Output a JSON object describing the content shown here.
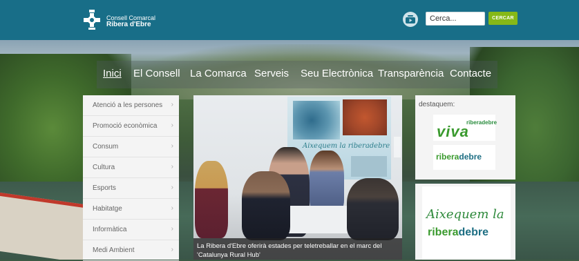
{
  "header": {
    "logo": {
      "line1": "Consell Comarcal",
      "line2": "Ribera d'Ebre"
    },
    "youtube_icon": "youtube-icon",
    "search": {
      "placeholder": "Cerca...",
      "value": "Cerca...",
      "button_label": "CERCAR"
    },
    "colors": {
      "bar": "#186e88",
      "search_button": "#86b817"
    }
  },
  "nav": {
    "items": [
      {
        "label": "Inici",
        "active": true
      },
      {
        "label": "El Consell"
      },
      {
        "label": "La Comarca"
      },
      {
        "label": "Serveis"
      },
      {
        "label": "Seu Electrònica"
      },
      {
        "label": "Transparència"
      },
      {
        "label": "Contacte"
      }
    ]
  },
  "sidebar": {
    "items": [
      {
        "label": "Atenció a les persones"
      },
      {
        "label": "Promoció econòmica"
      },
      {
        "label": "Consum"
      },
      {
        "label": "Cultura"
      },
      {
        "label": "Esports"
      },
      {
        "label": "Habitatge"
      },
      {
        "label": "Informàtica"
      },
      {
        "label": "Medi Ambient"
      }
    ],
    "arrow": "›"
  },
  "slider": {
    "caption": "La Ribera d'Ebre oferirà estades per teletreballar en el marc del 'Catalunya Rural Hub'",
    "poster_text": "Aixequem la riberadebre"
  },
  "featured": {
    "heading": "destaquem:",
    "viva": {
      "small": "riberadebre",
      "big": "viva"
    },
    "ribera": {
      "part1": "ribera",
      "part2": "debre"
    },
    "aixequem": {
      "line1": "Aixequem la",
      "part1": "ribera",
      "part2": "debre"
    }
  }
}
